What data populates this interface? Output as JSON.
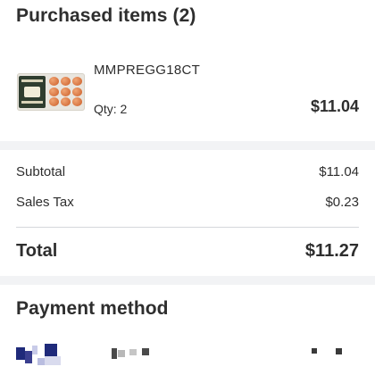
{
  "purchased": {
    "title": "Purchased items (2)",
    "items": [
      {
        "name": "MMPREGG18CT",
        "qty": "Qty: 2",
        "price": "$11.04",
        "image_icon": "egg-carton-product-image"
      }
    ]
  },
  "summary": {
    "subtotal_label": "Subtotal",
    "subtotal_value": "$11.04",
    "tax_label": "Sales Tax",
    "tax_value": "$0.23",
    "total_label": "Total",
    "total_value": "$11.27"
  },
  "payment": {
    "title": "Payment method",
    "card_logo_icon": "card-brand-logo-icon"
  },
  "colors": {
    "text": "#2e2e2e",
    "divider": "#f2f3f5",
    "rule": "#d5d7db",
    "card_logo_navy": "#1f2a7a"
  }
}
